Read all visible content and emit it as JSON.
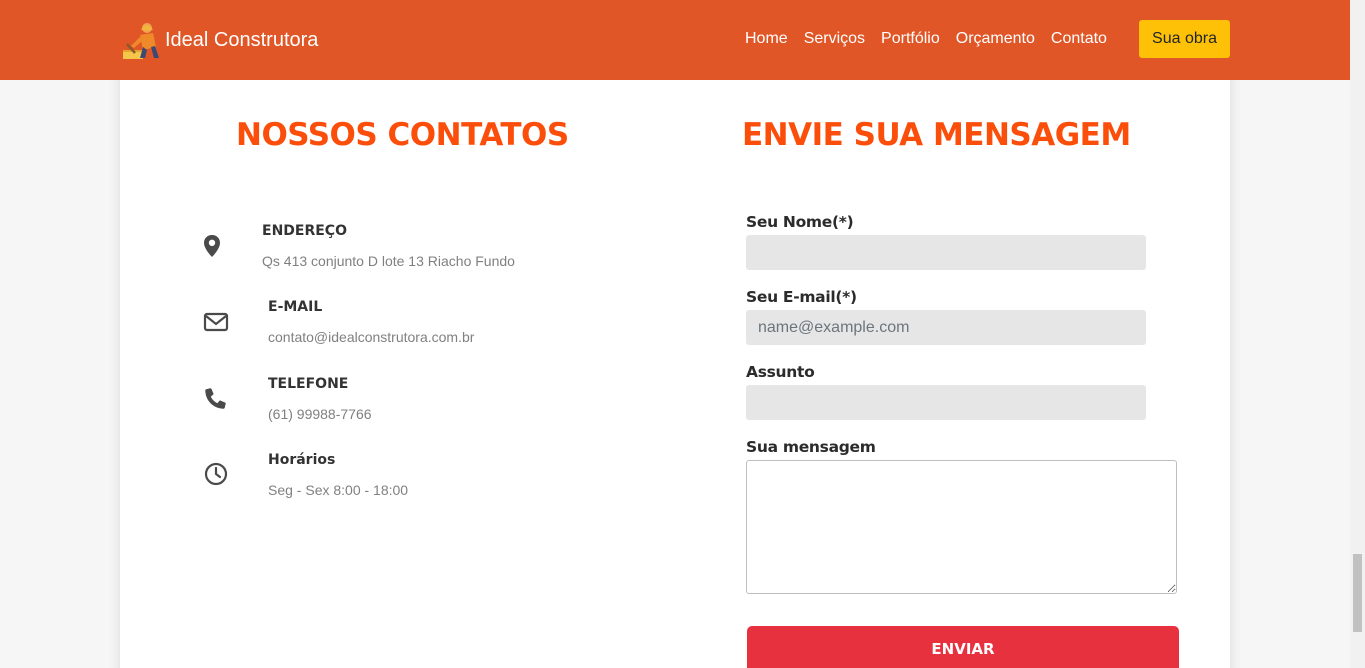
{
  "brand": {
    "name": "Ideal Construtora",
    "icon": "construction-worker-icon"
  },
  "nav": {
    "links": [
      "Home",
      "Serviços",
      "Portfólio",
      "Orçamento",
      "Contato"
    ],
    "cta": "Sua obra"
  },
  "contacts": {
    "title": "NOSSOS CONTATOS",
    "items": [
      {
        "heading": "ENDEREÇO",
        "text": "Qs 413 conjunto D lote 13 Riacho Fundo",
        "icon": "map-marker-icon"
      },
      {
        "heading": "E-MAIL",
        "text": "contato@idealconstrutora.com.br",
        "icon": "envelope-icon"
      },
      {
        "heading": "TELEFONE",
        "text": "(61) 99988-7766",
        "icon": "phone-icon"
      },
      {
        "heading": "Horários",
        "text": "Seg - Sex 8:00 - 18:00",
        "icon": "clock-icon"
      }
    ]
  },
  "form": {
    "title": "ENVIE SUA MENSAGEM",
    "name_label": "Seu Nome(*)",
    "name_value": "",
    "email_label": "Seu E-mail(*)",
    "email_placeholder": "name@example.com",
    "subject_label": "Assunto",
    "subject_value": "",
    "message_label": "Sua mensagem",
    "message_value": "",
    "submit_label": "ENVIAR"
  },
  "colors": {
    "navbar": "#e05627",
    "accent_title": "#fb4e0b",
    "cta": "#ffc107",
    "submit": "#e8313f"
  }
}
